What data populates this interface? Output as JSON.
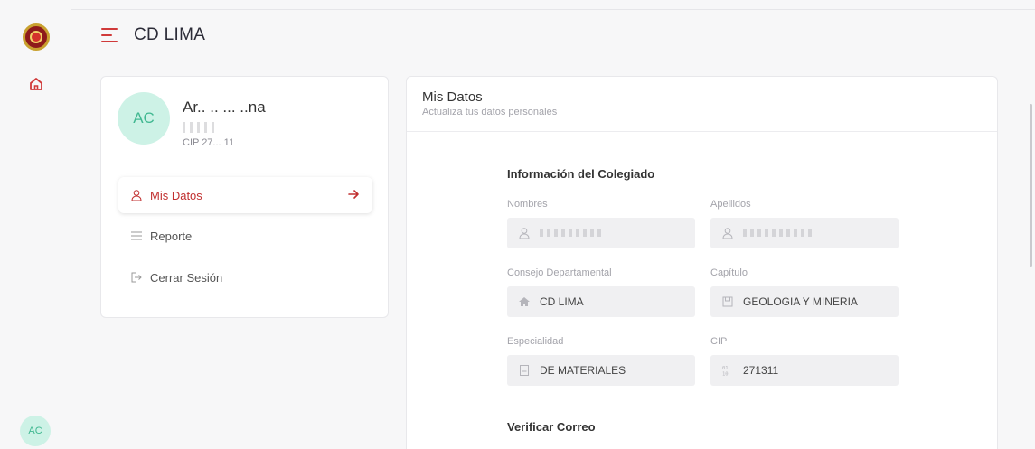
{
  "app": {
    "title": "CD LIMA"
  },
  "rail": {
    "avatar_initials": "AC"
  },
  "profile": {
    "initials": "AC",
    "name": "Ar..  .. ... ..na",
    "cip": "CIP 27... 11"
  },
  "menu": {
    "items": [
      {
        "label": "Mis Datos",
        "icon": "user-icon",
        "active": true
      },
      {
        "label": "Reporte",
        "icon": "list-icon",
        "active": false
      },
      {
        "label": "Cerrar Sesión",
        "icon": "logout-icon",
        "active": false
      }
    ]
  },
  "data_panel": {
    "title": "Mis Datos",
    "subtitle": "Actualiza tus datos personales",
    "section_info": "Información del Colegiado",
    "fields": {
      "nombres": {
        "label": "Nombres",
        "value": "",
        "icon": "user-icon"
      },
      "apellidos": {
        "label": "Apellidos",
        "value": "",
        "icon": "user-icon"
      },
      "consejo": {
        "label": "Consejo Departamental",
        "value": "CD LIMA",
        "icon": "home-icon"
      },
      "capitulo": {
        "label": "Capítulo",
        "value": "GEOLOGIA Y MINERIA",
        "icon": "book-icon"
      },
      "especialidad": {
        "label": "Especialidad",
        "value": "DE MATERIALES",
        "icon": "document-icon"
      },
      "cip": {
        "label": "CIP",
        "value": "271311",
        "icon": "binary-icon"
      }
    },
    "section_email": "Verificar Correo"
  },
  "colors": {
    "accent": "#d03a3a",
    "avatar_bg": "#cdf2e6",
    "avatar_text": "#41b891"
  }
}
